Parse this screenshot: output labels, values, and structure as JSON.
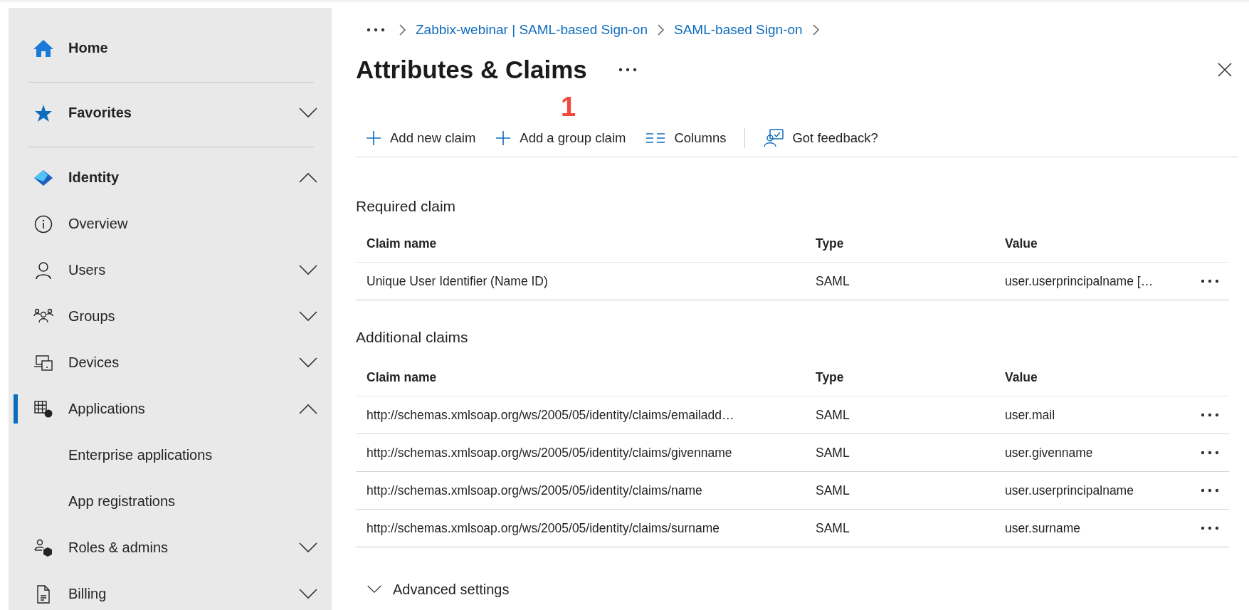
{
  "sidebar": {
    "items": [
      {
        "kind": "section",
        "label": "Home",
        "selected": false
      },
      {
        "kind": "divider"
      },
      {
        "kind": "section",
        "label": "Favorites",
        "expanded": false,
        "selected": false
      },
      {
        "kind": "divider"
      },
      {
        "kind": "section",
        "label": "Identity",
        "expanded": true,
        "selected": false
      },
      {
        "kind": "item",
        "label": "Overview",
        "selected": false
      },
      {
        "kind": "item",
        "label": "Users",
        "expanded": false,
        "selected": false
      },
      {
        "kind": "item",
        "label": "Groups",
        "expanded": false,
        "selected": false
      },
      {
        "kind": "item",
        "label": "Devices",
        "expanded": false,
        "selected": false
      },
      {
        "kind": "item",
        "label": "Applications",
        "expanded": true,
        "selected": true
      },
      {
        "kind": "subitem",
        "label": "Enterprise applications",
        "selected": false
      },
      {
        "kind": "subitem",
        "label": "App registrations",
        "selected": false
      },
      {
        "kind": "item",
        "label": "Roles & admins",
        "expanded": false,
        "selected": false
      },
      {
        "kind": "item",
        "label": "Billing",
        "expanded": false,
        "selected": false
      }
    ]
  },
  "breadcrumb": {
    "links": [
      "Zabbix-webinar | SAML-based Sign-on",
      "SAML-based Sign-on"
    ]
  },
  "page": {
    "title": "Attributes & Claims",
    "annotation": "1"
  },
  "toolbar": [
    {
      "kind": "add",
      "label": "Add new claim"
    },
    {
      "kind": "add",
      "label": "Add a group claim"
    },
    {
      "kind": "columns",
      "label": "Columns"
    },
    {
      "kind": "feedback",
      "label": "Got feedback?"
    }
  ],
  "sections": [
    {
      "heading": "Required claim",
      "columns": [
        "Claim name",
        "Type",
        "Value"
      ],
      "rows": [
        [
          "Unique User Identifier (Name ID)",
          "SAML",
          "user.userprincipalname […"
        ]
      ]
    },
    {
      "heading": "Additional claims",
      "columns": [
        "Claim name",
        "Type",
        "Value"
      ],
      "rows": [
        [
          "http://schemas.xmlsoap.org/ws/2005/05/identity/claims/emailadd…",
          "SAML",
          "user.mail"
        ],
        [
          "http://schemas.xmlsoap.org/ws/2005/05/identity/claims/givenname",
          "SAML",
          "user.givenname"
        ],
        [
          "http://schemas.xmlsoap.org/ws/2005/05/identity/claims/name",
          "SAML",
          "user.userprincipalname"
        ],
        [
          "http://schemas.xmlsoap.org/ws/2005/05/identity/claims/surname",
          "SAML",
          "user.surname"
        ]
      ]
    }
  ],
  "advanced": {
    "label": "Advanced settings",
    "expanded": false
  }
}
